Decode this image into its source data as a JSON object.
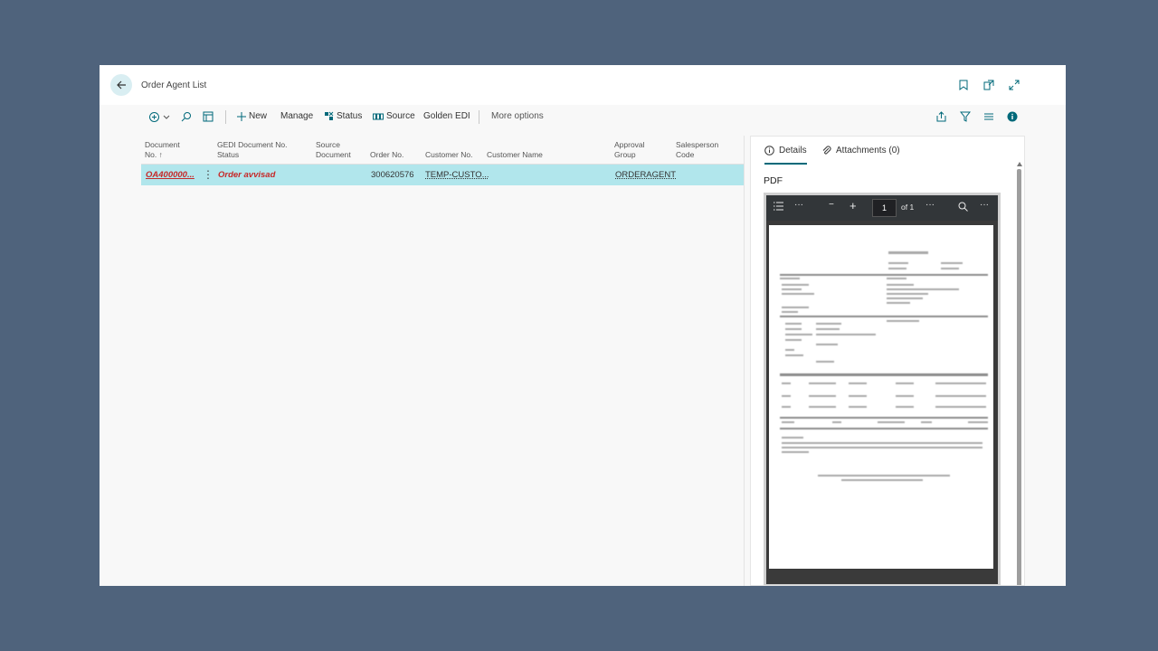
{
  "window": {
    "title": "Order Agent List"
  },
  "actions": {
    "new": "New",
    "manage": "Manage",
    "status": "Status",
    "source": "Source",
    "golden_edi": "Golden EDI",
    "more_options": "More options"
  },
  "table": {
    "headers": {
      "document_no_line1": "Document",
      "document_no_line2": "No. ↑",
      "gedi_status_line1": "GEDI Document No.",
      "gedi_status_line2": "Status",
      "source_doc_line1": "Source",
      "source_doc_line2": "Document",
      "order_no": "Order No.",
      "customer_no": "Customer No.",
      "customer_name": "Customer Name",
      "approval_line1": "Approval",
      "approval_line2": "Group",
      "salesperson_line1": "Salesperson",
      "salesperson_line2": "Code"
    },
    "rows": [
      {
        "document_no": "OA400000...",
        "gedi_status": "Order avvisad",
        "source_document": "",
        "order_no": "300620576",
        "customer_no": "TEMP-CUSTO...",
        "customer_name": "",
        "approval_group": "ORDERAGENT",
        "salesperson_code": ""
      }
    ]
  },
  "factbox": {
    "tab_details": "Details",
    "tab_attachments": "Attachments (0)",
    "pdf_label": "PDF",
    "pdf_viewer": {
      "page": "1",
      "of_pages": "of 1"
    }
  },
  "colors": {
    "background": "#4f637c",
    "selected_row": "#b1e6ec",
    "accent": "#00697a",
    "error_text": "#c62828"
  }
}
